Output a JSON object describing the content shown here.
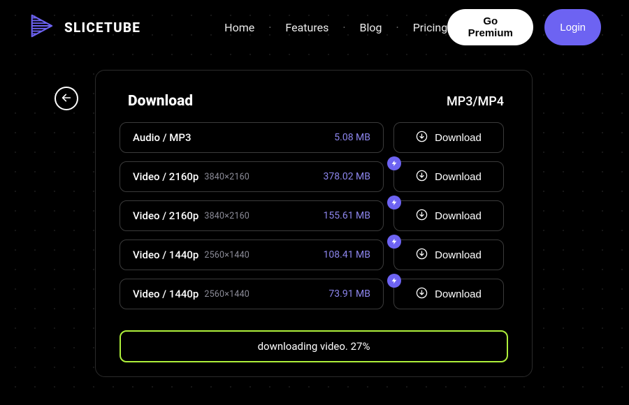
{
  "brand": {
    "name": "SLICETUBE"
  },
  "nav": {
    "home": "Home",
    "features": "Features",
    "blog": "Blog",
    "pricing": "Pricing"
  },
  "buttons": {
    "premium": "Go Premium",
    "login": "Login",
    "download": "Download"
  },
  "panel": {
    "title": "Download",
    "formats": "MP3/MP4",
    "status": "downloading video. 27%"
  },
  "rows": [
    {
      "label": "Audio / MP3",
      "dims": "",
      "size": "5.08 MB",
      "bolt": false
    },
    {
      "label": "Video / 2160p",
      "dims": "3840×2160",
      "size": "378.02 MB",
      "bolt": true
    },
    {
      "label": "Video / 2160p",
      "dims": "3840×2160",
      "size": "155.61 MB",
      "bolt": true
    },
    {
      "label": "Video / 1440p",
      "dims": "2560×1440",
      "size": "108.41 MB",
      "bolt": true
    },
    {
      "label": "Video / 1440p",
      "dims": "2560×1440",
      "size": "73.91 MB",
      "bolt": true
    }
  ],
  "colors": {
    "accent": "#6d63f2",
    "highlight": "#aef03b"
  }
}
